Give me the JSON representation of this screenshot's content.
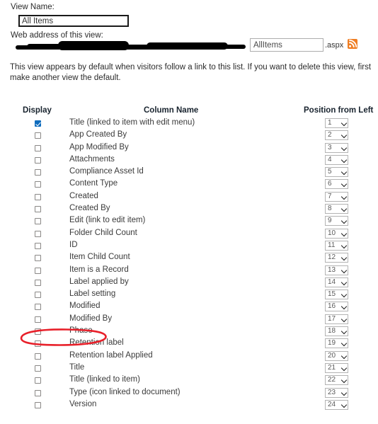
{
  "form": {
    "view_name_label": "View Name:",
    "view_name_value": "All Items",
    "web_address_label": "Web address of this view:",
    "url_file_value": "AllItems",
    "url_extension": ".aspx",
    "rss_icon": "rss-icon",
    "description": "This view appears by default when visitors follow a link to this list. If you want to delete this view, first make another view the default."
  },
  "columns_table": {
    "headers": {
      "display": "Display",
      "column_name": "Column Name",
      "position": "Position from Left"
    },
    "rows": [
      {
        "name": "Title (linked to item with edit menu)",
        "checked": true,
        "position": "1"
      },
      {
        "name": "App Created By",
        "checked": false,
        "position": "2"
      },
      {
        "name": "App Modified By",
        "checked": false,
        "position": "3"
      },
      {
        "name": "Attachments",
        "checked": false,
        "position": "4"
      },
      {
        "name": "Compliance Asset Id",
        "checked": false,
        "position": "5"
      },
      {
        "name": "Content Type",
        "checked": false,
        "position": "6"
      },
      {
        "name": "Created",
        "checked": false,
        "position": "7"
      },
      {
        "name": "Created By",
        "checked": false,
        "position": "8"
      },
      {
        "name": "Edit (link to edit item)",
        "checked": false,
        "position": "9"
      },
      {
        "name": "Folder Child Count",
        "checked": false,
        "position": "10"
      },
      {
        "name": "ID",
        "checked": false,
        "position": "11"
      },
      {
        "name": "Item Child Count",
        "checked": false,
        "position": "12"
      },
      {
        "name": "Item is a Record",
        "checked": false,
        "position": "13"
      },
      {
        "name": "Label applied by",
        "checked": false,
        "position": "14"
      },
      {
        "name": "Label setting",
        "checked": false,
        "position": "15"
      },
      {
        "name": "Modified",
        "checked": false,
        "position": "16"
      },
      {
        "name": "Modified By",
        "checked": false,
        "position": "17"
      },
      {
        "name": "Phase",
        "checked": false,
        "position": "18",
        "annotated": true
      },
      {
        "name": "Retention label",
        "checked": false,
        "position": "19"
      },
      {
        "name": "Retention label Applied",
        "checked": false,
        "position": "20"
      },
      {
        "name": "Title",
        "checked": false,
        "position": "21"
      },
      {
        "name": "Title (linked to item)",
        "checked": false,
        "position": "22"
      },
      {
        "name": "Type (icon linked to document)",
        "checked": false,
        "position": "23"
      },
      {
        "name": "Version",
        "checked": false,
        "position": "24"
      }
    ]
  },
  "annotation": {
    "target_row": "Phase",
    "shape": "ellipse",
    "color": "#e8202a"
  }
}
